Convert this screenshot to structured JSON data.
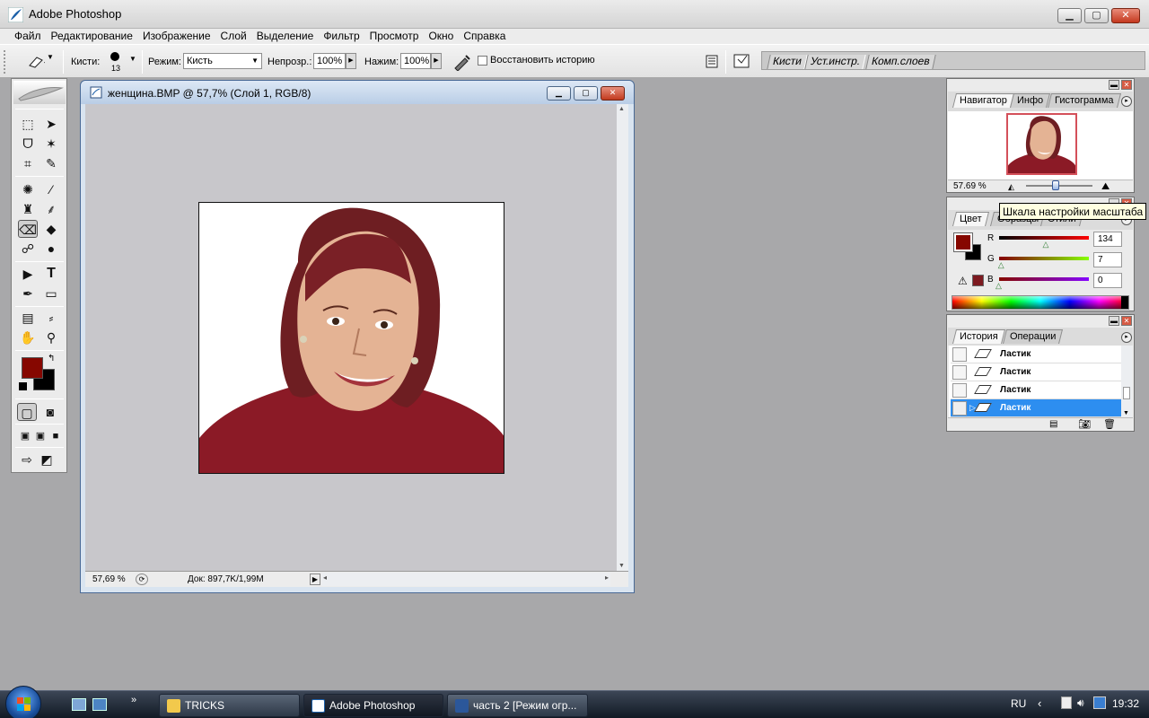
{
  "app": {
    "title": "Adobe Photoshop"
  },
  "menu": [
    "Файл",
    "Редактирование",
    "Изображение",
    "Слой",
    "Выделение",
    "Фильтр",
    "Просмотр",
    "Окно",
    "Справка"
  ],
  "options": {
    "brush_label": "Кисти:",
    "brush_size": "13",
    "mode_label": "Режим:",
    "mode_value": "Кисть",
    "opacity_label": "Непрозр.:",
    "opacity_value": "100%",
    "flow_label": "Нажим:",
    "flow_value": "100%",
    "restore_history_label": "Восстановить историю",
    "restore_history_checked": false
  },
  "palette_well_tabs": [
    "Кисти",
    "Уст.инстр.",
    "Комп.слоев"
  ],
  "document": {
    "title": "женщина.BMP @ 57,7% (Слой 1, RGB/8)",
    "zoom": "57,69 %",
    "doc_size": "Док: 897,7K/1,99M"
  },
  "navigator": {
    "tabs": [
      "Навигатор",
      "Инфо",
      "Гистограмма"
    ],
    "zoom": "57.69 %",
    "zoom_slider": 0.45
  },
  "tooltip": "Шкала настройки масштаба",
  "color": {
    "tabs": [
      "Цвет",
      "Образцы",
      "Стили"
    ],
    "r_label": "R",
    "r_value": "134",
    "g_label": "G",
    "g_value": "7",
    "b_label": "B",
    "b_value": "0",
    "fg": "#860700",
    "bg": "#000000"
  },
  "history": {
    "tabs": [
      "История",
      "Операции"
    ],
    "items": [
      "Ластик",
      "Ластик",
      "Ластик",
      "Ластик"
    ],
    "selected_index": 3
  },
  "toolbox": {
    "fg": "#860700",
    "bg": "#000000"
  },
  "taskbar": {
    "buttons": [
      "TRICKS",
      "Adobe Photoshop",
      "часть 2 [Режим огр..."
    ],
    "active_index": 1,
    "lang": "RU",
    "clock": "19:32"
  }
}
